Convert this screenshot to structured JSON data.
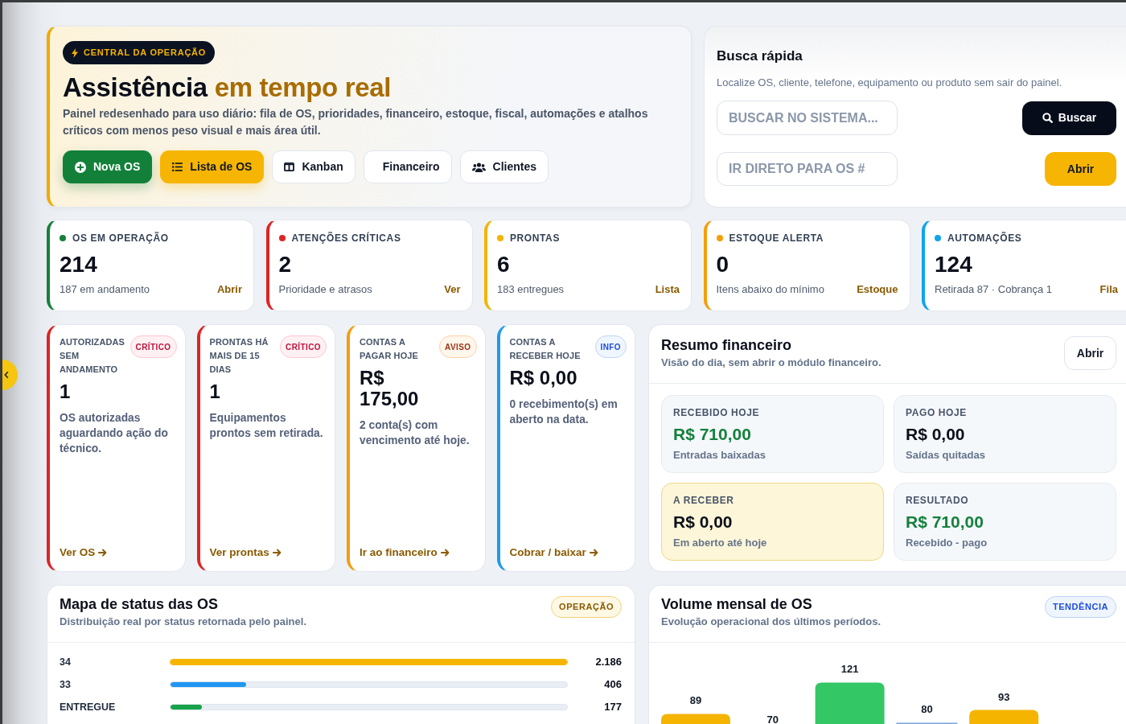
{
  "hero": {
    "badge": "CENTRAL DA OPERAÇÃO",
    "title": {
      "lead": "Assistência",
      "highlight": "em tempo real"
    },
    "description": "Painel redesenhado para uso diário: fila de OS, prioridades, financeiro, estoque, fiscal, automações e atalhos críticos com menos peso visual e mais área útil.",
    "actions": [
      {
        "label": "Nova OS",
        "kind": "success"
      },
      {
        "label": "Lista de OS",
        "kind": "accent"
      },
      {
        "label": "Kanban",
        "kind": "outline"
      },
      {
        "label": "Financeiro",
        "kind": "outline"
      },
      {
        "label": "Clientes",
        "kind": "outline"
      }
    ]
  },
  "quick_search": {
    "title": "Busca rápida",
    "description": "Localize OS, cliente, telefone, equipamento ou produto sem sair do painel.",
    "search_field": {
      "placeholder": "BUSCAR NO SISTEMA..."
    },
    "search_button": "Buscar",
    "order_field": {
      "placeholder": "IR DIRETO PARA OS #"
    },
    "open_button": "Abrir"
  },
  "kpis": [
    {
      "label": "OS EM OPERAÇÃO",
      "value": "214",
      "caption": "187 em andamento",
      "link": "Abrir",
      "color": "#15803d"
    },
    {
      "label": "ATENÇÕES CRÍTICAS",
      "value": "2",
      "caption": "Prioridade e atrasos",
      "link": "Ver",
      "color": "#dc2626"
    },
    {
      "label": "PRONTAS",
      "value": "6",
      "caption": "183 entregues",
      "link": "Lista",
      "color": "#f5b400"
    },
    {
      "label": "ESTOQUE ALERTA",
      "value": "0",
      "caption": "Itens abaixo do mínimo",
      "link": "Estoque",
      "color": "#f59e0b"
    },
    {
      "label": "AUTOMAÇÕES",
      "value": "124",
      "caption": "Retirada 87 · Cobrança 1",
      "link": "Fila",
      "color": "#0ea5e9"
    }
  ],
  "alerts": [
    {
      "title": "AUTORIZADAS SEM ANDAMENTO",
      "badge": "CRÍTICO",
      "kind": "critical",
      "value": "1",
      "description": "OS autorizadas aguardando ação do técnico.",
      "link": "Ver OS"
    },
    {
      "title": "PRONTAS HÁ MAIS DE 15 DIAS",
      "badge": "CRÍTICO",
      "kind": "critical",
      "value": "1",
      "description": "Equipamentos prontos sem retirada.",
      "link": "Ver prontas"
    },
    {
      "title": "CONTAS A PAGAR HOJE",
      "badge": "AVISO",
      "kind": "warning",
      "value": "R$ 175,00",
      "description": "2 conta(s) com vencimento até hoje.",
      "link": "Ir ao financeiro"
    },
    {
      "title": "CONTAS A RECEBER HOJE",
      "badge": "INFO",
      "kind": "info",
      "value": "R$ 0,00",
      "description": "0 recebimento(s) em aberto na data.",
      "link": "Cobrar / baixar"
    }
  ],
  "finance_summary": {
    "title": "Resumo financeiro",
    "subtitle": "Visão do dia, sem abrir o módulo financeiro.",
    "button": "Abrir",
    "tiles": [
      {
        "label": "RECEBIDO HOJE",
        "value": "R$ 710,00",
        "caption": "Entradas baixadas",
        "kind": "plain",
        "color": "#15803d"
      },
      {
        "label": "PAGO HOJE",
        "value": "R$ 0,00",
        "caption": "Saídas quitadas",
        "kind": "plain",
        "color": "#0b0f1a"
      },
      {
        "label": "A RECEBER",
        "value": "R$ 0,00",
        "caption": "Em aberto até hoje",
        "kind": "highlight",
        "color": "#0b0f1a"
      },
      {
        "label": "RESULTADO",
        "value": "R$ 710,00",
        "caption": "Recebido - pago",
        "kind": "plain",
        "color": "#15803d"
      }
    ]
  },
  "status_map": {
    "title": "Mapa de status das OS",
    "subtitle": "Distribuição real por status retornada pelo painel.",
    "badge": "OPERAÇÃO",
    "rows": [
      {
        "label": "34",
        "level": 1,
        "value": "2.186",
        "color": "#f5b400"
      },
      {
        "label": "33",
        "level": 0.19,
        "value": "406",
        "color": "#2196f3"
      },
      {
        "label": "ENTREGUE",
        "level": 0.08,
        "value": "177",
        "color": "#16a34a"
      }
    ]
  },
  "monthly_volume": {
    "title": "Volume mensal de OS",
    "subtitle": "Evolução operacional dos últimos períodos.",
    "badge": "TENDÊNCIA",
    "bars": [
      {
        "label": "89",
        "color": "#f5b400"
      },
      {
        "label": "70"
      },
      {
        "label": "121",
        "color": "#34c766"
      },
      {
        "label": "80",
        "color": "#7ea9df"
      },
      {
        "label": "93",
        "color": "#f5b400"
      }
    ]
  }
}
